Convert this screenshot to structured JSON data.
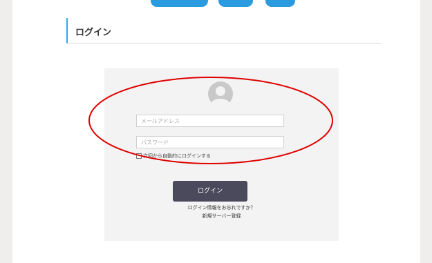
{
  "header": {
    "title": "ログイン"
  },
  "login": {
    "email_placeholder": "メールアドレス",
    "password_placeholder": "パスワード",
    "remember_label": "次回から自動的にログインする",
    "login_button": "ログイン",
    "forgot_link": "ログイン情報をお忘れですか？",
    "register_link": "新規サーバー登録"
  },
  "colors": {
    "accent": "#2b9be0",
    "button": "#4a4a5c",
    "annotation": "#e00000"
  }
}
